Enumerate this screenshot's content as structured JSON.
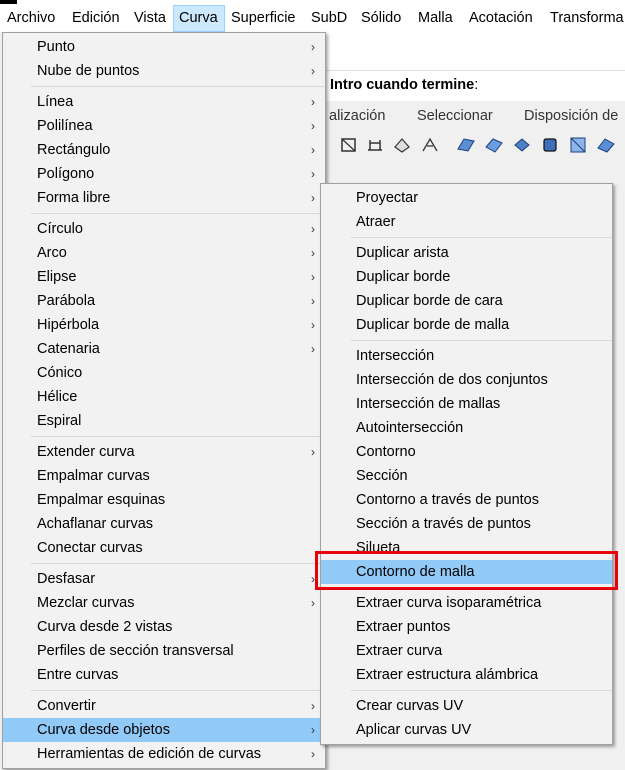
{
  "menubar": [
    "Archivo",
    "Edición",
    "Vista",
    "Curva",
    "Superficie",
    "SubD",
    "Sólido",
    "Malla",
    "Acotación",
    "Transforma"
  ],
  "command_prompt": {
    "text": "Intro cuando termine",
    "suffix": ":"
  },
  "view_tabs": [
    "alización",
    "Seleccionar",
    "Disposición de"
  ],
  "curve_menu": {
    "items": [
      "Punto",
      "Nube de puntos",
      "Línea",
      "Polilínea",
      "Rectángulo",
      "Polígono",
      "Forma libre",
      "Círculo",
      "Arco",
      "Elipse",
      "Parábola",
      "Hipérbola",
      "Catenaria",
      "Cónico",
      "Hélice",
      "Espiral",
      "Extender curva",
      "Empalmar curvas",
      "Empalmar esquinas",
      "Achaflanar curvas",
      "Conectar curvas",
      "Desfasar",
      "Mezclar curvas",
      "Curva desde 2 vistas",
      "Perfiles de sección transversal",
      "Entre curvas",
      "Convertir",
      "Curva desde objetos",
      "Herramientas de edición de curvas"
    ],
    "highlighted": "Curva desde objetos"
  },
  "submenu": {
    "items": [
      "Proyectar",
      "Atraer",
      "Duplicar arista",
      "Duplicar borde",
      "Duplicar borde de cara",
      "Duplicar borde de malla",
      "Intersección",
      "Intersección de dos conjuntos",
      "Intersección de mallas",
      "Autointersección",
      "Contorno",
      "Sección",
      "Contorno a través de puntos",
      "Sección a través de puntos",
      "Silueta",
      "Contorno de malla",
      "Extraer curva isoparamétrica",
      "Extraer puntos",
      "Extraer curva",
      "Extraer estructura alámbrica",
      "Crear curvas UV",
      "Aplicar curvas UV"
    ],
    "highlighted": "Contorno de malla"
  },
  "chevron_glyph": "›",
  "colors": {
    "highlight": "#91c9f7",
    "active_menu": "#cce8ff",
    "callout": "#e8000b"
  }
}
